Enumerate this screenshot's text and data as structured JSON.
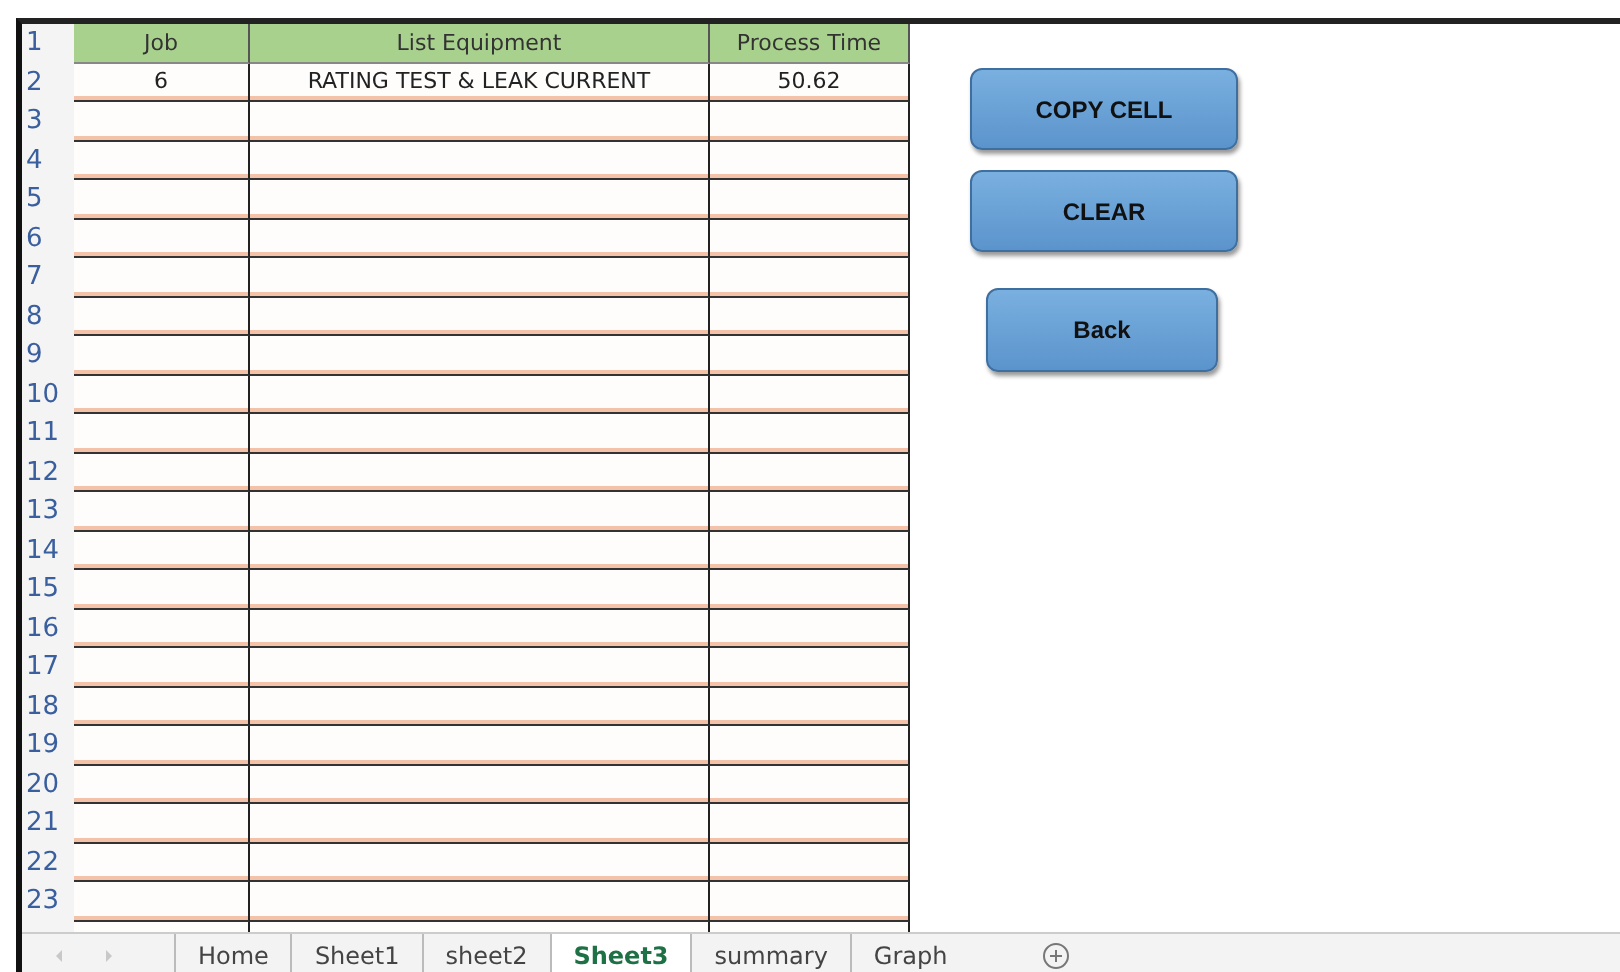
{
  "sheet": {
    "columns": [
      "Job",
      "List Equipment",
      "Process Time"
    ],
    "header_row": "1",
    "rows": [
      {
        "number": "2",
        "cells": [
          "6",
          "RATING TEST & LEAK CURRENT",
          "50.62"
        ]
      },
      {
        "number": "3"
      },
      {
        "number": "4"
      },
      {
        "number": "5"
      },
      {
        "number": "6"
      },
      {
        "number": "7"
      },
      {
        "number": "8"
      },
      {
        "number": "9"
      },
      {
        "number": "10"
      },
      {
        "number": "11"
      },
      {
        "number": "12"
      },
      {
        "number": "13"
      },
      {
        "number": "14"
      },
      {
        "number": "15"
      },
      {
        "number": "16"
      },
      {
        "number": "17"
      },
      {
        "number": "18"
      },
      {
        "number": "19"
      },
      {
        "number": "20"
      },
      {
        "number": "21"
      },
      {
        "number": "22"
      },
      {
        "number": "23"
      }
    ]
  },
  "buttons": [
    "COPY CELL",
    "CLEAR",
    "Back"
  ],
  "tabs": [
    {
      "label": "Home",
      "selected": false
    },
    {
      "label": "Sheet1",
      "selected": false
    },
    {
      "label": "sheet2",
      "selected": false
    },
    {
      "label": "Sheet3",
      "selected": true
    },
    {
      "label": "summary",
      "selected": false
    },
    {
      "label": "Graph",
      "selected": false
    }
  ]
}
